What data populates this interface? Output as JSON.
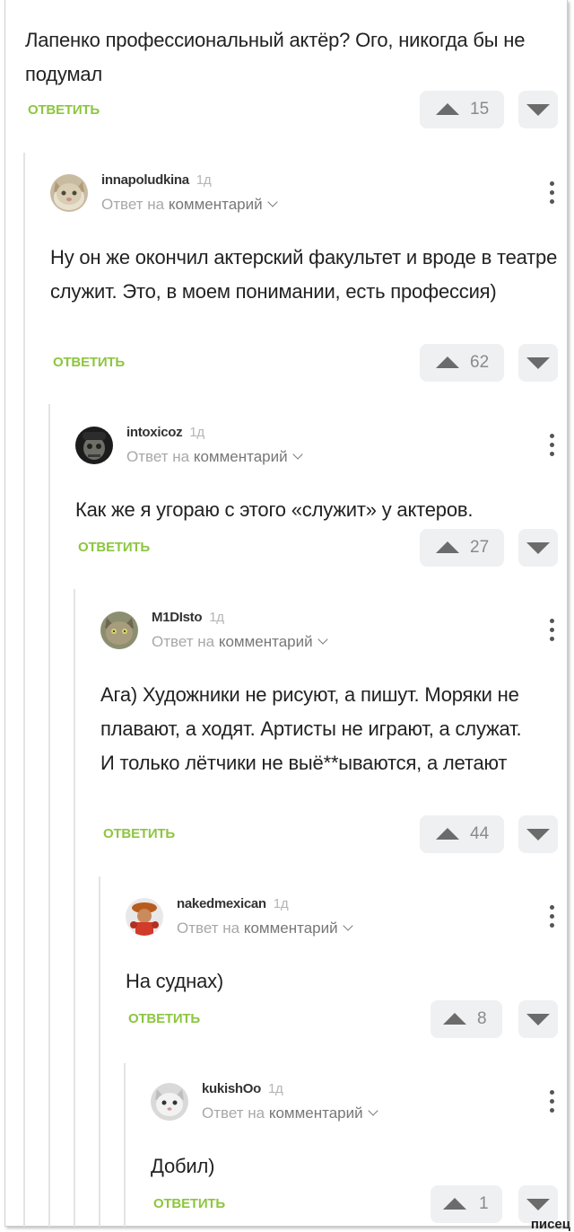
{
  "root_comment": {
    "text": "Лапенко профессиональный актёр? Ого, никогда бы не подумал",
    "reply_label": "ОТВЕТИТЬ",
    "votes": "15"
  },
  "replies": [
    {
      "username": "innapoludkina",
      "age": "1д",
      "reply_prefix": "Ответ на",
      "reply_target": "комментарий",
      "text": "Ну он же окончил актерский факультет и вроде в театре служит. Это, в моем понимании, есть профессия)",
      "reply_label": "ОТВЕТИТЬ",
      "votes": "62"
    },
    {
      "username": "intoxicoz",
      "age": "1д",
      "reply_prefix": "Ответ на",
      "reply_target": "комментарий",
      "text": "Как же я угораю с этого «служит» у актеров.",
      "reply_label": "ОТВЕТИТЬ",
      "votes": "27"
    },
    {
      "username": "M1DIsto",
      "age": "1д",
      "reply_prefix": "Ответ на",
      "reply_target": "комментарий",
      "text": "Ага) Художники не рисуют, а пишут. Моряки не плавают, а ходят. Артисты не играют, а служат. И только лётчики не выё**ываются, а летают",
      "reply_label": "ОТВЕТИТЬ",
      "votes": "44"
    },
    {
      "username": "nakedmexican",
      "age": "1д",
      "reply_prefix": "Ответ на",
      "reply_target": "комментарий",
      "text": "На суднах)",
      "reply_label": "ОТВЕТИТЬ",
      "votes": "8"
    },
    {
      "username": "kukishOo",
      "age": "1д",
      "reply_prefix": "Ответ на",
      "reply_target": "комментарий",
      "text": "Добил)",
      "reply_label": "ОТВЕТИТЬ",
      "votes": "1"
    }
  ],
  "colors": {
    "accent_green": "#8cc63f",
    "vote_bg": "#eef0f2",
    "thread_line": "#e4e4e4"
  },
  "icons": {
    "upvote": "triangle-up-icon",
    "downvote": "triangle-down-icon",
    "menu": "kebab-menu-icon",
    "expand": "chevron-down-icon"
  },
  "watermark": "писец"
}
